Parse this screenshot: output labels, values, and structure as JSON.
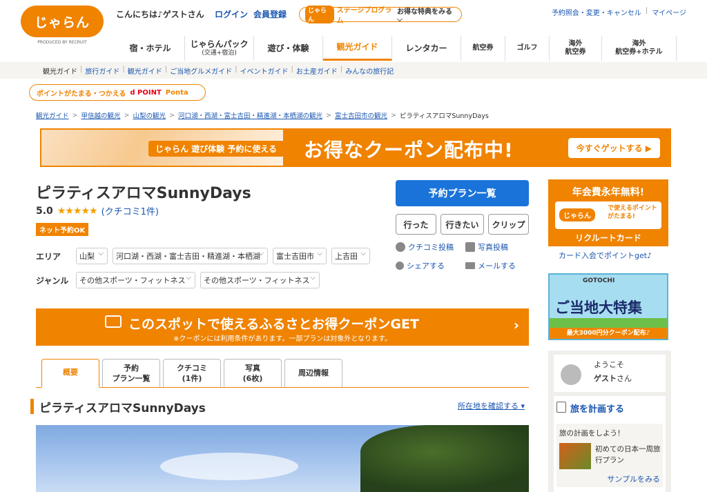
{
  "header": {
    "logo_text": "じゃらん",
    "logo_sub": "PRODUCED BY RECRUIT",
    "greeting": "こんにちは♪ゲストさん",
    "login": "ログイン",
    "register": "会員登録",
    "stage_logo": "じゃらん",
    "stage_program": "ステージプログラム",
    "stage_text": "お得な特典をみる ⌵",
    "top_links": [
      "予約照会・変更・キャンセル",
      "マイページ"
    ]
  },
  "main_nav": [
    {
      "label": "宿・ホテル"
    },
    {
      "label": "じゃらんパック",
      "sub": "(交通+宿泊)"
    },
    {
      "label": "遊び・体験"
    },
    {
      "label": "観光ガイド",
      "active": true
    },
    {
      "label": "レンタカー"
    },
    {
      "label": "航空券"
    },
    {
      "label": "ゴルフ"
    },
    {
      "label": "海外",
      "sub": "航空券"
    },
    {
      "label": "海外",
      "sub": "航空券+ホテル"
    }
  ],
  "sub_nav": [
    "観光ガイド",
    "旅行ガイド",
    "観光ガイド",
    "ご当地グルメガイド",
    "イベントガイド",
    "お土産ガイド",
    "みんなの旅行記"
  ],
  "point_banner": {
    "text": "ポイントがたまる・つかえる",
    "dpoint": "d POINT",
    "ponta": "Ponta"
  },
  "breadcrumb": [
    "観光ガイド",
    "甲信越の観光",
    "山梨の観光",
    "河口湖・西湖・富士吉田・精進湖・本栖湖の観光",
    "富士吉田市の観光",
    "ピラティスアロマSunnyDays"
  ],
  "coupon_banner": {
    "label": "じゃらん 遊び体験 予約に使える",
    "main": "お得なクーポン配布中!",
    "button": "今すぐゲットする ▶"
  },
  "spot": {
    "title": "ピラティスアロマSunnyDays",
    "score": "5.0",
    "stars": "★★★★★",
    "reviews": "(クチコミ1件)",
    "badge": "ネット予約OK",
    "area_label": "エリア",
    "areas": [
      "山梨",
      "河口湖・西湖・富士吉田・精進湖・本栖湖",
      "富士吉田市",
      "上吉田"
    ],
    "genre_label": "ジャンル",
    "genres": [
      "その他スポーツ・フィットネス",
      "その他スポーツ・フィットネス"
    ]
  },
  "actions": {
    "reserve": "予約プラン一覧",
    "went": "行った",
    "want": "行きたい",
    "clip": "クリップ",
    "review_post": "クチコミ投稿",
    "photo_post": "写真投稿",
    "share": "シェアする",
    "mail": "メールする"
  },
  "furusato": {
    "main": "このスポットで使えるふるさとお得クーポンGET",
    "sub": "※クーポンには利用条件があります。一部プランは対象外となります。",
    "chev": "›"
  },
  "tabs": [
    {
      "l1": "概要",
      "active": true
    },
    {
      "l1": "予約",
      "l2": "プラン一覧"
    },
    {
      "l1": "クチコミ",
      "l2": "(1件)"
    },
    {
      "l1": "写真",
      "l2": "(6枚)"
    },
    {
      "l1": "周辺情報"
    }
  ],
  "section": {
    "title": "ピラティスアロマSunnyDays",
    "locate": "所在地を確認する ▾"
  },
  "sidebar": {
    "card_ad": {
      "t1": "年会費永年無料!",
      "jalan": "じゃらん",
      "mid": "で使えるポイントがたまる!",
      "t2": "リクルートカード"
    },
    "card_link": "カード入会でポイントget♪",
    "gotochi": {
      "top": "GOTOCHI",
      "main": "ご当地大特集",
      "bot": "最大3000円分クーポン配布♪"
    },
    "welcome_l1": "ようこそ",
    "welcome_name": "ゲスト",
    "welcome_suffix": "さん",
    "plan_head": "旅を計画する",
    "plan_desc": "旅の計画をしよう！",
    "plan_name": "初めての日本一周旅行プラン",
    "plan_sample": "サンプルをみる"
  }
}
